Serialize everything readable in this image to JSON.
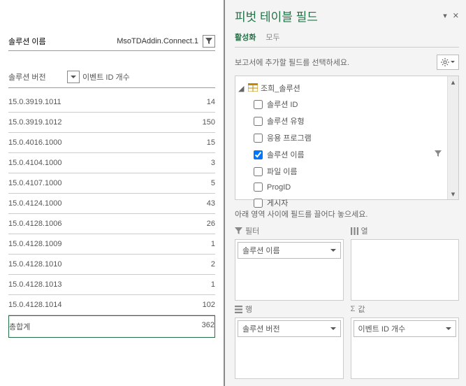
{
  "left": {
    "solution_name_label": "솔루션 이름",
    "solution_name_value": "MsoTDAddin.Connect.1",
    "header_version": "솔루션 버전",
    "header_count": "이벤트 ID 개수",
    "rows": [
      {
        "v": "15.0.3919.1011",
        "n": "14"
      },
      {
        "v": "15.0.3919.1012",
        "n": "150"
      },
      {
        "v": "15.0.4016.1000",
        "n": "15"
      },
      {
        "v": "15.0.4104.1000",
        "n": "3"
      },
      {
        "v": "15.0.4107.1000",
        "n": "5"
      },
      {
        "v": "15.0.4124.1000",
        "n": "43"
      },
      {
        "v": "15.0.4128.1006",
        "n": "26"
      },
      {
        "v": "15.0.4128.1009",
        "n": "1"
      },
      {
        "v": "15.0.4128.1010",
        "n": "2"
      },
      {
        "v": "15.0.4128.1013",
        "n": "1"
      },
      {
        "v": "15.0.4128.1014",
        "n": "102"
      }
    ],
    "total_label": "총합계",
    "total_value": "362"
  },
  "right": {
    "title": "피벗 테이블 필드",
    "tabs": {
      "active": "활성화",
      "all": "모두"
    },
    "prompt": "보고서에 추가할 필드를 선택하세요.",
    "tree_root": "조희_솔루션",
    "fields": [
      {
        "label": "솔루션 ID",
        "checked": false
      },
      {
        "label": "솔루션 유형",
        "checked": false
      },
      {
        "label": "응용 프로그램",
        "checked": false
      },
      {
        "label": "솔루션 이름",
        "checked": true,
        "filtered": true
      },
      {
        "label": "파일 이름",
        "checked": false
      },
      {
        "label": "ProgID",
        "checked": false
      },
      {
        "label": "게시자",
        "checked": false
      }
    ],
    "drop_prompt": "아래 영역 사이에 필드를 끌어다 놓으세요.",
    "areas": {
      "filter_label": "필터",
      "filter_item": "솔루션 이름",
      "column_label": "열",
      "row_label": "행",
      "row_item": "솔루션 버전",
      "value_label": "값",
      "value_item": "이벤트 ID 개수"
    }
  }
}
